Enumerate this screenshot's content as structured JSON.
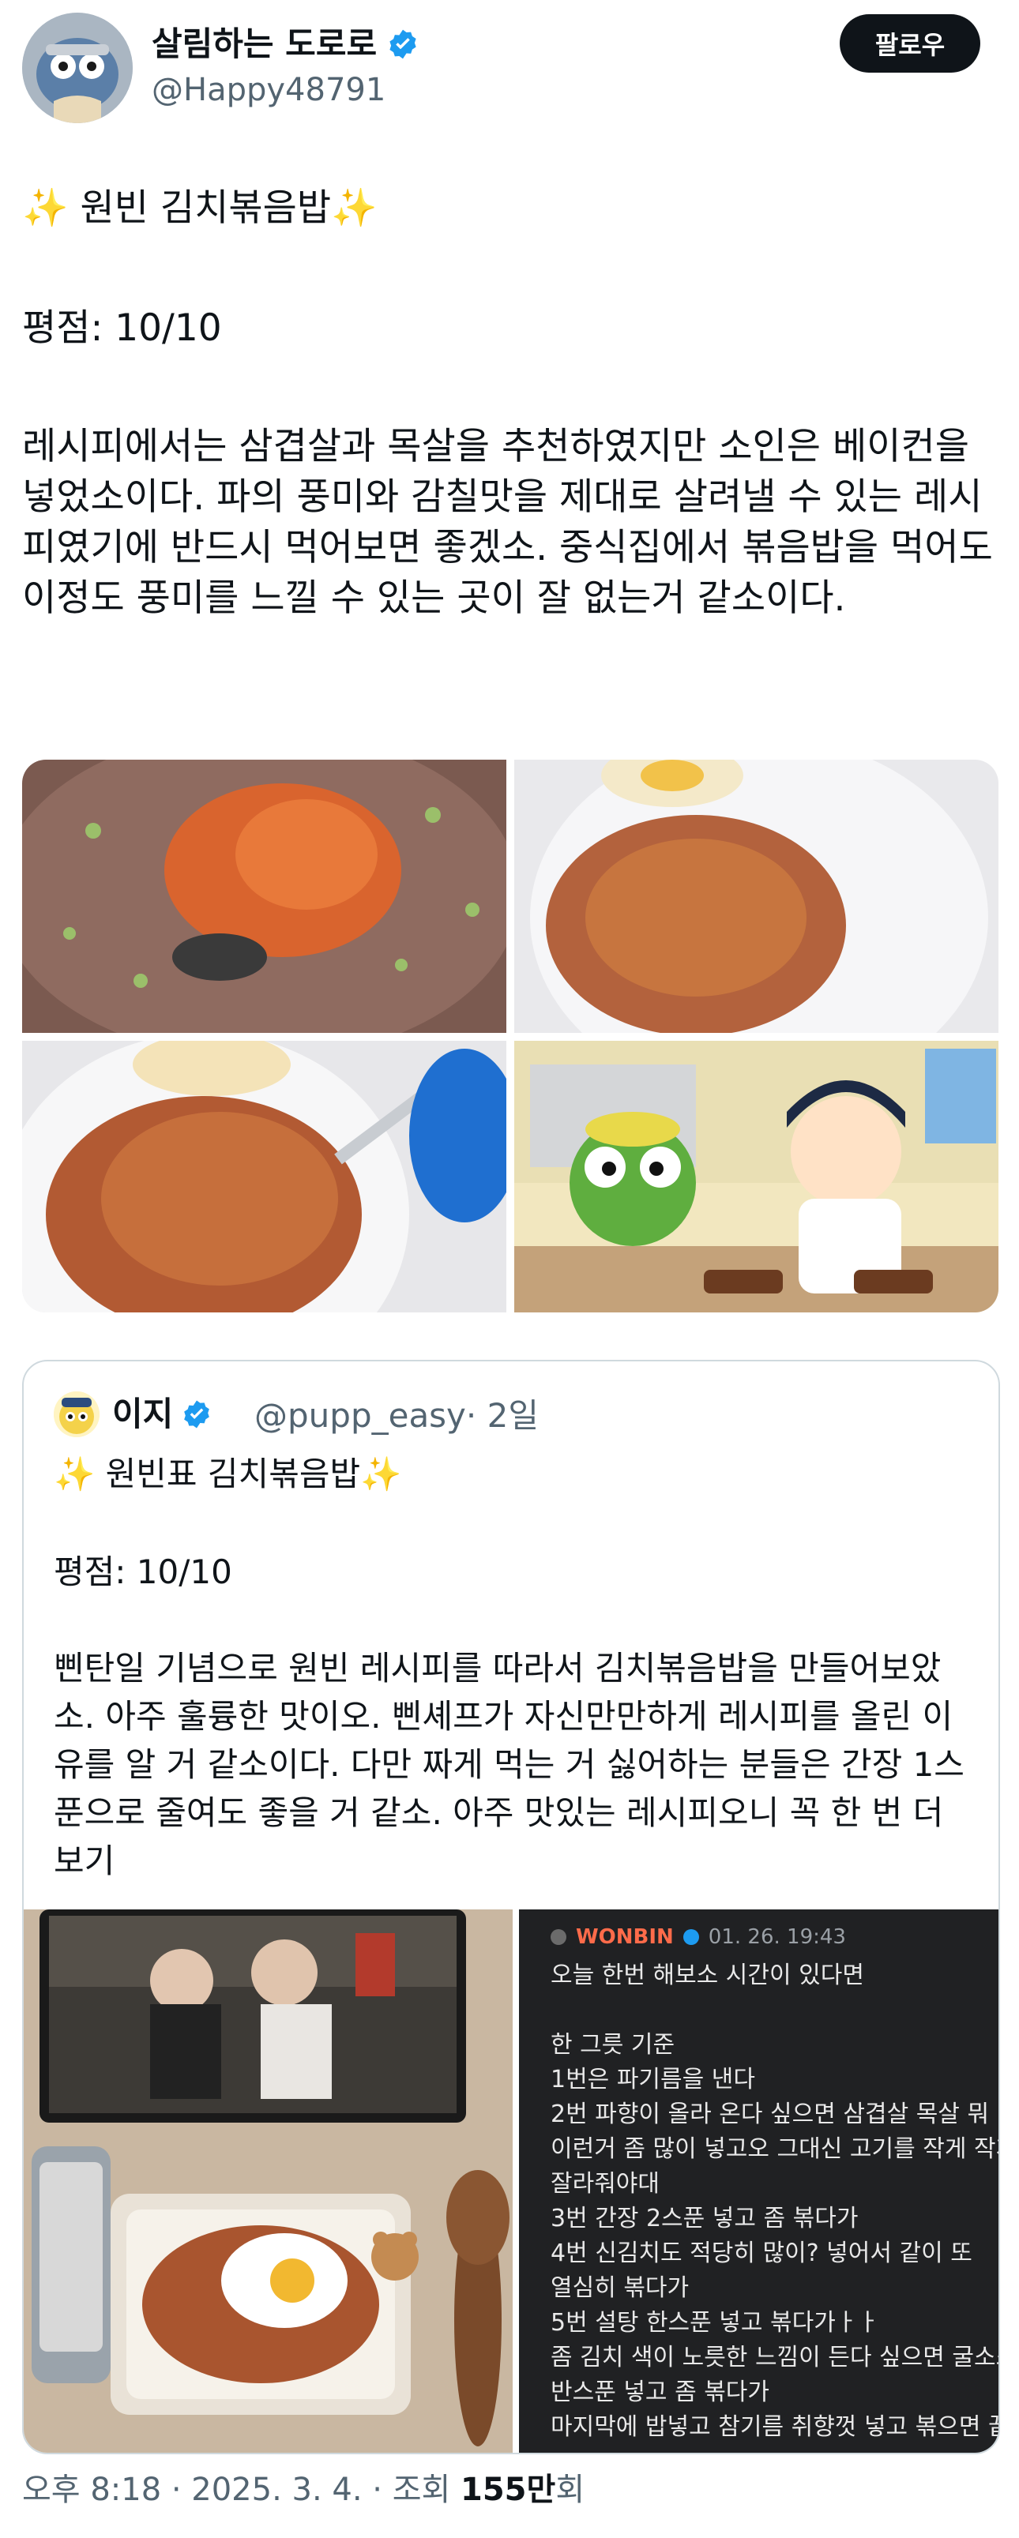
{
  "author": {
    "display_name": "살림하는 도로로",
    "handle": "@Happy48791",
    "follow_label": "팔로우"
  },
  "tweet": {
    "title": "✨ 원빈 김치볶음밥✨",
    "rating": "평점: 10/10",
    "body": "레시피에서는 삼겹살과 목살을 추천하였지만 소인은 베이컨을 넣었소이다. 파의 풍미와 감칠맛을 제대로 살려낼 수 있는 레시피였기에 반드시 먹어보면 좋겠소. 중식집에서 볶음밥을 먹어도 이정도 풍미를 느낄 수 있는 곳이 잘 없는거 같소이다.",
    "timestamp": "오후 8:18 · 2025. 3. 4. · 조회 ",
    "views": "155만",
    "views_suffix": "회"
  },
  "quote": {
    "display_name": "이지",
    "handle": "@pupp_easy",
    "time": "· 2일",
    "title": "✨ 원빈표 김치볶음밥✨",
    "rating": "평점: 10/10",
    "body": "삔탄일 기념으로 원빈 레시피를 따라서 김치볶음밥을 만들어보았소. 아주 훌륭한 맛이오. 삔셰프가 자신만만하게 레시피를 올린 이유를 알 거 같소이다. 다만 짜게 먹는 거 싫어하는 분들은 간장 1스푼으로 줄여도 좋을 거 같소. 아주 맛있는 레시피오니 꼭 한 번 더 보기"
  },
  "chat": {
    "name": "WONBIN",
    "time": "01. 26. 19:43",
    "lines": [
      "오늘 한번 해보소 시간이 있다면",
      "",
      "한 그릇 기준",
      "1번은 파기름을 낸다",
      "2번 파향이 올라 온다 싶으면 삼겹살 목살 뭐",
      "이런거  좀 많이 넣고오 그대신 고기를 작게 작게",
      "잘라줘야대",
      "3번 간장 2스푼 넣고 좀 볶다가",
      "4번 신김치도 적당히 많이? 넣어서 같이 또",
      "열심히 볶다가",
      "5번 설탕 한스푼 넣고 볶다가ㅏㅏ",
      "좀 김치 색이 노릇한 느낌이 든다 싶으면 굴소스",
      "반스푼 넣고 좀 볶다가",
      "마지막에 밥넣고 참기름 취향껏 넣고 볶으면 끝!"
    ]
  },
  "colors": {
    "verified": "#1d9bf0",
    "follow_bg": "#0f1419",
    "muted": "#536471",
    "chat_name": "#ff6b4a"
  },
  "icons": [
    "verified-badge-icon",
    "sparkles-icon"
  ]
}
